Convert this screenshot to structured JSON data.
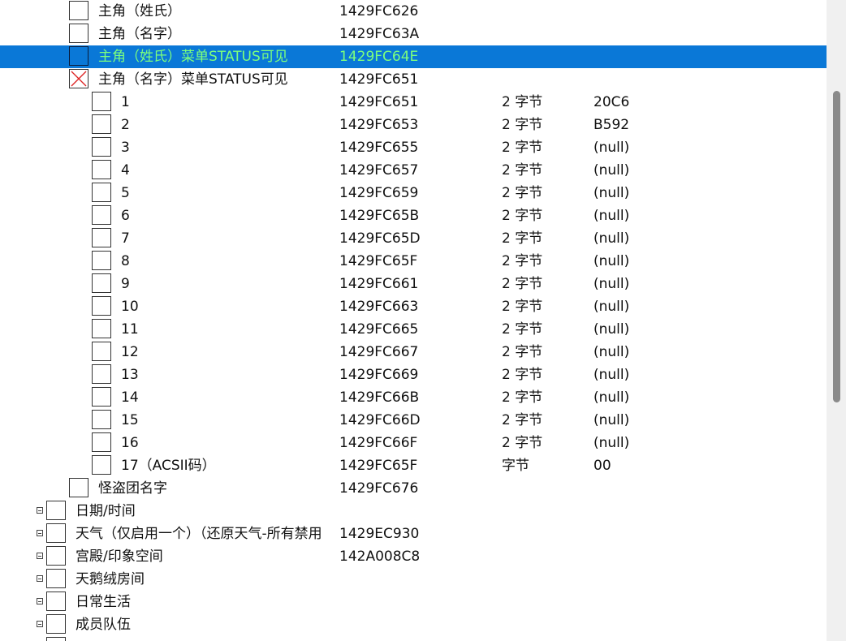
{
  "table": {
    "rows": [
      {
        "desc": "主角（姓氏）",
        "addr": "1429FC626",
        "type": "",
        "value": "",
        "level": 1,
        "checked": false,
        "selected": false,
        "expander": false
      },
      {
        "desc": "主角（名字）",
        "addr": "1429FC63A",
        "type": "",
        "value": "",
        "level": 1,
        "checked": false,
        "selected": false,
        "expander": false
      },
      {
        "desc": "主角（姓氏）菜单STATUS可见",
        "addr": "1429FC64E",
        "type": "",
        "value": "",
        "level": 1,
        "checked": false,
        "selected": true,
        "expander": false
      },
      {
        "desc": "主角（名字）菜单STATUS可见",
        "addr": "1429FC651",
        "type": "",
        "value": "",
        "level": 1,
        "checked": true,
        "selected": false,
        "expander": false
      },
      {
        "desc": "1",
        "addr": "1429FC651",
        "type": "2 字节",
        "value": "20C6",
        "level": 2,
        "checked": false,
        "selected": false,
        "expander": false
      },
      {
        "desc": "2",
        "addr": "1429FC653",
        "type": "2 字节",
        "value": "B592",
        "level": 2,
        "checked": false,
        "selected": false,
        "expander": false
      },
      {
        "desc": "3",
        "addr": "1429FC655",
        "type": "2 字节",
        "value": "(null)",
        "level": 2,
        "checked": false,
        "selected": false,
        "expander": false
      },
      {
        "desc": "4",
        "addr": "1429FC657",
        "type": "2 字节",
        "value": "(null)",
        "level": 2,
        "checked": false,
        "selected": false,
        "expander": false
      },
      {
        "desc": "5",
        "addr": "1429FC659",
        "type": "2 字节",
        "value": "(null)",
        "level": 2,
        "checked": false,
        "selected": false,
        "expander": false
      },
      {
        "desc": "6",
        "addr": "1429FC65B",
        "type": "2 字节",
        "value": "(null)",
        "level": 2,
        "checked": false,
        "selected": false,
        "expander": false
      },
      {
        "desc": "7",
        "addr": "1429FC65D",
        "type": "2 字节",
        "value": "(null)",
        "level": 2,
        "checked": false,
        "selected": false,
        "expander": false
      },
      {
        "desc": "8",
        "addr": "1429FC65F",
        "type": "2 字节",
        "value": "(null)",
        "level": 2,
        "checked": false,
        "selected": false,
        "expander": false
      },
      {
        "desc": "9",
        "addr": "1429FC661",
        "type": "2 字节",
        "value": "(null)",
        "level": 2,
        "checked": false,
        "selected": false,
        "expander": false
      },
      {
        "desc": "10",
        "addr": "1429FC663",
        "type": "2 字节",
        "value": "(null)",
        "level": 2,
        "checked": false,
        "selected": false,
        "expander": false
      },
      {
        "desc": "11",
        "addr": "1429FC665",
        "type": "2 字节",
        "value": "(null)",
        "level": 2,
        "checked": false,
        "selected": false,
        "expander": false
      },
      {
        "desc": "12",
        "addr": "1429FC667",
        "type": "2 字节",
        "value": "(null)",
        "level": 2,
        "checked": false,
        "selected": false,
        "expander": false
      },
      {
        "desc": "13",
        "addr": "1429FC669",
        "type": "2 字节",
        "value": "(null)",
        "level": 2,
        "checked": false,
        "selected": false,
        "expander": false
      },
      {
        "desc": "14",
        "addr": "1429FC66B",
        "type": "2 字节",
        "value": "(null)",
        "level": 2,
        "checked": false,
        "selected": false,
        "expander": false
      },
      {
        "desc": "15",
        "addr": "1429FC66D",
        "type": "2 字节",
        "value": "(null)",
        "level": 2,
        "checked": false,
        "selected": false,
        "expander": false
      },
      {
        "desc": "16",
        "addr": "1429FC66F",
        "type": "2 字节",
        "value": "(null)",
        "level": 2,
        "checked": false,
        "selected": false,
        "expander": false
      },
      {
        "desc": "17（ACSII码）",
        "addr": "1429FC65F",
        "type": "字节",
        "value": "00",
        "level": 2,
        "checked": false,
        "selected": false,
        "expander": false
      },
      {
        "desc": "怪盗团名字",
        "addr": "1429FC676",
        "type": "",
        "value": "",
        "level": 1,
        "checked": false,
        "selected": false,
        "expander": false
      },
      {
        "desc": "日期/时间",
        "addr": "",
        "type": "",
        "value": "",
        "level": 0,
        "checked": false,
        "selected": false,
        "expander": true
      },
      {
        "desc": "天气（仅启用一个）（还原天气-所有禁用",
        "addr": "1429EC930",
        "type": "",
        "value": "",
        "level": 0,
        "checked": false,
        "selected": false,
        "expander": true
      },
      {
        "desc": "宫殿/印象空间",
        "addr": "142A008C8",
        "type": "",
        "value": "",
        "level": 0,
        "checked": false,
        "selected": false,
        "expander": true
      },
      {
        "desc": "天鹅绒房间",
        "addr": "",
        "type": "",
        "value": "",
        "level": 0,
        "checked": false,
        "selected": false,
        "expander": true
      },
      {
        "desc": "日常生活",
        "addr": "",
        "type": "",
        "value": "",
        "level": 0,
        "checked": false,
        "selected": false,
        "expander": true
      },
      {
        "desc": "成员队伍",
        "addr": "",
        "type": "",
        "value": "",
        "level": 0,
        "checked": false,
        "selected": false,
        "expander": true
      },
      {
        "desc": "",
        "addr": "",
        "type": "",
        "value": "",
        "level": 0,
        "checked": false,
        "selected": false,
        "expander": true
      }
    ]
  },
  "colors": {
    "selection": "#0a78d7",
    "selection_text": "#7dff7d",
    "scroll_thumb": "#8a8a8a",
    "scroll_track": "#f0f0f0"
  }
}
